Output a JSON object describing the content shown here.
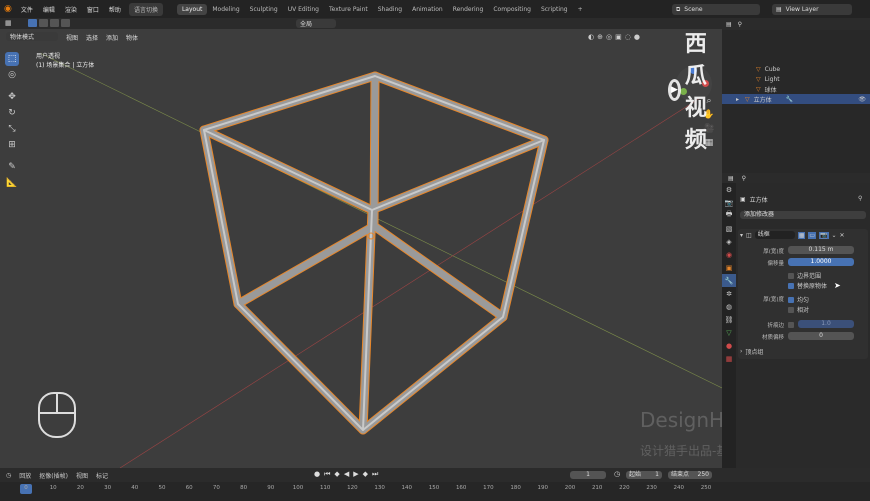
{
  "topbar": {
    "menus": [
      "文件",
      "编辑",
      "渲染",
      "窗口",
      "帮助"
    ],
    "switch_label": "语言切换",
    "workspaces": [
      "Layout",
      "Modeling",
      "Sculpting",
      "UV Editing",
      "Texture Paint",
      "Shading",
      "Animation",
      "Rendering",
      "Compositing",
      "Scripting"
    ],
    "add": "+",
    "scene": "Scene",
    "view_layer": "View Layer"
  },
  "viewport": {
    "mode": "物体模式",
    "menus": [
      "视图",
      "选择",
      "添加",
      "物体"
    ],
    "transform": "全局",
    "view_name": "用户透视",
    "object_info": "(1) 场景集合 | 立方体"
  },
  "outliner": {
    "rows": [
      {
        "name": "Cube"
      },
      {
        "name": "Light"
      },
      {
        "name": "球体"
      },
      {
        "name": "立方体"
      }
    ]
  },
  "properties": {
    "object_name": "立方体",
    "add_modifier": "添加修改器",
    "modifier_name": "线框",
    "thickness_label": "厚(宽)度",
    "thickness_value": "0.115 m",
    "offset_label": "偏移量",
    "offset_value": "1.0000",
    "boundary_label": "边界范围",
    "replace_label": "替换原物体",
    "thickness2_label": "厚(宽)度",
    "even_label": "均匀",
    "relative_label": "相对",
    "crease_label": "折痕边",
    "crease_value": "1.0",
    "material_label": "材质偏移",
    "material_value": "0",
    "vertex_group": "顶点组"
  },
  "timeline": {
    "menus": [
      "回放",
      "抠像(插帧)",
      "视图",
      "标记"
    ],
    "current_frame": "1",
    "start_label": "起始",
    "start_value": "1",
    "end_label": "结束点",
    "end_value": "250",
    "ticks": [
      "0",
      "10",
      "20",
      "30",
      "40",
      "50",
      "60",
      "70",
      "80",
      "90",
      "100",
      "110",
      "120",
      "130",
      "140",
      "150",
      "160",
      "170",
      "180",
      "190",
      "200",
      "210",
      "220",
      "230",
      "240",
      "250"
    ]
  },
  "watermark": {
    "logo": "西瓜视频",
    "line1": "DesignHunting",
    "line2": "设计猎手出品-基础部分"
  }
}
